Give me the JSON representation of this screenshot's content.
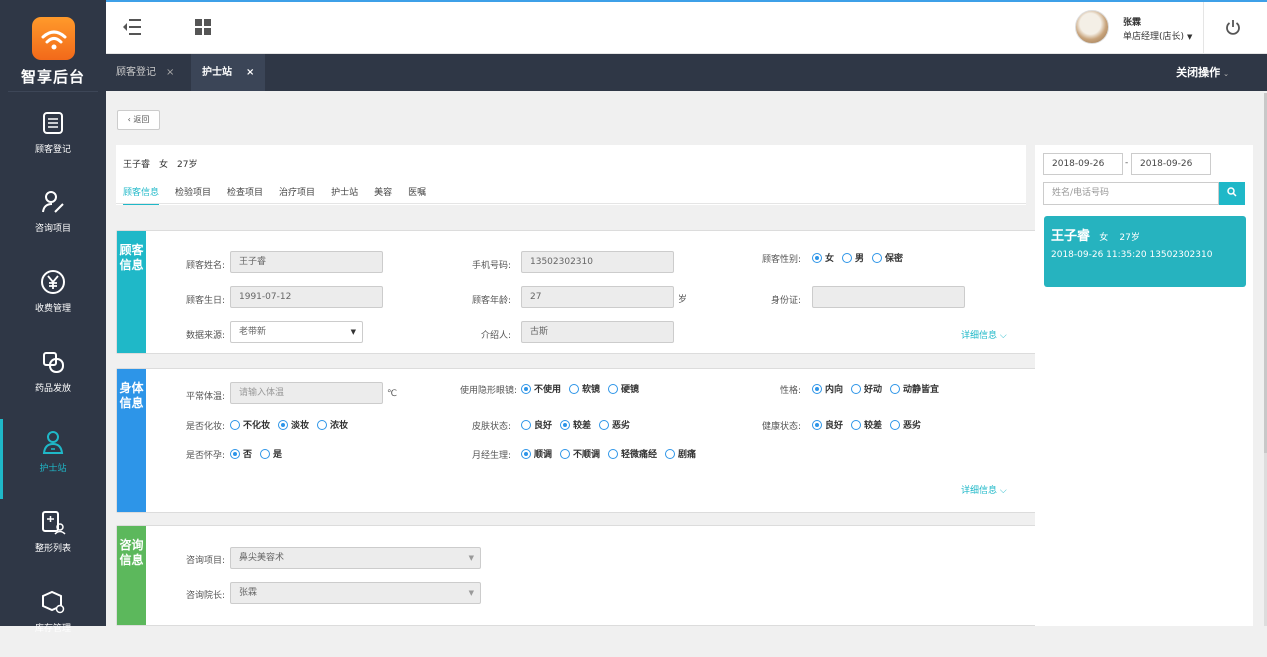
{
  "app": {
    "title": "智享后台"
  },
  "sidebar": {
    "items": [
      {
        "label": "顾客登记"
      },
      {
        "label": "咨询项目"
      },
      {
        "label": "收费管理"
      },
      {
        "label": "药品发放"
      },
      {
        "label": "护士站"
      },
      {
        "label": "整形列表"
      },
      {
        "label": "库存管理"
      }
    ]
  },
  "user": {
    "name": "张霖",
    "role": "单店经理(店长)"
  },
  "tabs": [
    {
      "label": "顾客登记"
    },
    {
      "label": "护士站"
    }
  ],
  "tab_close": "×",
  "close_ops": "关闭操作",
  "back_label": "返回",
  "patient": {
    "name": "王子睿",
    "gender": "女",
    "age": "27岁"
  },
  "subtabs": [
    "顾客信息",
    "检验项目",
    "检查项目",
    "治疗项目",
    "护士站",
    "美容",
    "医嘱"
  ],
  "more_label": "详细信息",
  "customer": {
    "side": "顾客信息",
    "name_label": "顾客姓名:",
    "name": "王子睿",
    "phone_label": "手机号码:",
    "phone": "13502302310",
    "gender_label": "顾客性别:",
    "gender_opts": [
      "女",
      "男",
      "保密"
    ],
    "gender_sel": 0,
    "birth_label": "顾客生日:",
    "birth": "1991-07-12",
    "age_label": "顾客年龄:",
    "age": "27",
    "age_unit": "岁",
    "id_label": "身份证:",
    "id": "",
    "source_label": "数据来源:",
    "source": "老带新",
    "referrer_label": "介绍人:",
    "referrer": "古斯"
  },
  "body": {
    "side": "身体信息",
    "temp_label": "平常体温:",
    "temp_placeholder": "请输入体温",
    "temp_unit": "℃",
    "lens_label": "使用隐形眼镜:",
    "lens_opts": [
      "不使用",
      "软镜",
      "硬镜"
    ],
    "lens_sel": 0,
    "char_label": "性格:",
    "char_opts": [
      "内向",
      "好动",
      "动静皆宜"
    ],
    "char_sel": 0,
    "makeup_label": "是否化妆:",
    "makeup_opts": [
      "不化妆",
      "淡妆",
      "浓妆"
    ],
    "makeup_sel": 1,
    "skin_label": "皮肤状态:",
    "skin_opts": [
      "良好",
      "较差",
      "恶劣"
    ],
    "skin_sel": 1,
    "health_label": "健康状态:",
    "health_opts": [
      "良好",
      "较差",
      "恶劣"
    ],
    "health_sel": 0,
    "preg_label": "是否怀孕:",
    "preg_opts": [
      "否",
      "是"
    ],
    "preg_sel": 0,
    "mens_label": "月经生理:",
    "mens_opts": [
      "顺调",
      "不顺调",
      "轻微痛经",
      "剧痛"
    ],
    "mens_sel": 0
  },
  "consult": {
    "side": "咨询信息",
    "item_label": "咨询项目:",
    "item": "鼻尖美容术",
    "dean_label": "咨询院长:",
    "dean": "张霖"
  },
  "right": {
    "date_from": "2018-09-26",
    "date_to": "2018-09-26",
    "date_sep": "-",
    "search_placeholder": "姓名/电话号码",
    "card": {
      "name": "王子睿",
      "gender": "女",
      "age": "27岁",
      "time": "2018-09-26 11:35:20",
      "phone": "13502302310"
    }
  },
  "colors": {
    "sidebar": "#2f3746",
    "accent": "#1fb8c8",
    "customer_side": "#1fb8c8",
    "body_side": "#2d95e8",
    "consult_side": "#5cb85c"
  }
}
